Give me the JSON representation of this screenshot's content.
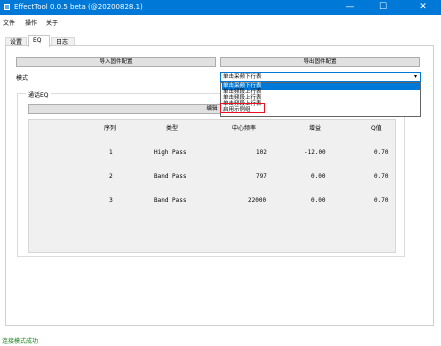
{
  "window": {
    "title": "EffectTool 0.0.5 beta (@20200828.1)",
    "minimize": "—",
    "maximize": "☐",
    "close": "✕"
  },
  "menu": [
    "文件",
    "操作",
    "关于"
  ],
  "tabs": [
    "设置",
    "EQ",
    "日志"
  ],
  "toolbar": {
    "import_label": "导入固件配置",
    "export_label": "导出固件配置"
  },
  "mode": {
    "label": "模式",
    "selected": "单击采频下行表",
    "options": [
      "单击采频下行表",
      "单击频段上行表",
      "单击频段上行表",
      "单击频段上行表",
      "启用示例组"
    ]
  },
  "group": {
    "title": "通话EQ",
    "edit_label": "编辑"
  },
  "table": {
    "columns": [
      "序列",
      "类型",
      "中心频率",
      "增益",
      "Q值"
    ],
    "rows": [
      [
        "1",
        "High Pass",
        "102",
        "-12.00",
        "0.70"
      ],
      [
        "2",
        "Band Pass",
        "797",
        "0.00",
        "0.70"
      ],
      [
        "3",
        "Band Pass",
        "22000",
        "0.00",
        "0.70"
      ]
    ]
  },
  "status": "连接模式成功",
  "colors": {
    "titlebar": "#0078d7",
    "selection": "#0078d7",
    "highlight_box": "#e81123",
    "status_text": "#1a7f1a"
  }
}
